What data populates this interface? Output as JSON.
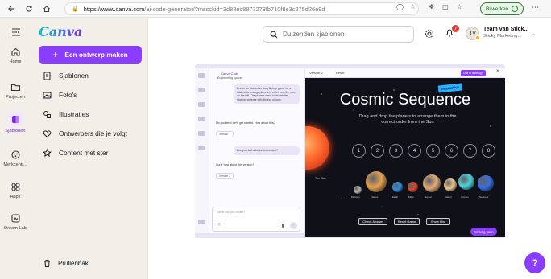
{
  "browser": {
    "url_host": "https://www.canva.com",
    "url_path": "/ai-code-generator/?mssckid=3d88ec8877278fb710f8e3c275d26e9d",
    "extension_label": "Bijwerken"
  },
  "brand": {
    "logo": "Canva",
    "accent": "#8b3dff"
  },
  "rail": {
    "items": [
      {
        "label": "Home",
        "icon": "home-icon"
      },
      {
        "label": "Projecten",
        "icon": "folder-icon"
      },
      {
        "label": "Sjablonen",
        "icon": "templates-icon"
      },
      {
        "label": "Merkcentr...",
        "icon": "brand-icon"
      },
      {
        "label": "Apps",
        "icon": "apps-icon"
      },
      {
        "label": "Dream Lab",
        "icon": "dream-lab-icon"
      }
    ]
  },
  "panel": {
    "create_label": "Een ontwerp maken",
    "menu": [
      {
        "label": "Sjablonen",
        "icon": "document-icon"
      },
      {
        "label": "Foto's",
        "icon": "image-icon"
      },
      {
        "label": "Illustraties",
        "icon": "shapes-icon"
      },
      {
        "label": "Ontwerpers die je volgt",
        "icon": "heart-icon"
      },
      {
        "label": "Content met ster",
        "icon": "star-icon"
      }
    ],
    "trash_label": "Prullenbak"
  },
  "topbar": {
    "search_placeholder": "Duizenden sjablonen",
    "notification_count": "7",
    "avatar_initials": "TV",
    "team_name": "Team van Stick...",
    "team_sub": "Sticky Marketing..."
  },
  "preview": {
    "chat": {
      "title": "Canva Code",
      "subtitle": "Engineering space",
      "bubble1": "Create an interactive drag & drop game for a student to arrange planets in order from the sun, on the left. The planets need to be detailed, glowing spheres with distinct colours.",
      "q1": "No problem! Let's get started. How about this?",
      "chip1": "Version 1",
      "bubble2": "Can you add a button for version?",
      "q2": "Sure, how about this version?",
      "chip2": "Version 2",
      "input_placeholder": "What will you create?"
    },
    "game": {
      "version_label": "Version 2",
      "reset_label": "Reset",
      "use_label": "Use in a design",
      "ribbon": "Interactive",
      "title": "Cosmic Sequence",
      "subtitle": "Drag and drop the planets to arrange them in the correct order from the Sun",
      "sun_label": "The Sun",
      "slots": [
        "1",
        "2",
        "3",
        "4",
        "5",
        "6",
        "7",
        "8"
      ],
      "planets": [
        {
          "name": "Mercury",
          "color": "#b9b4ae"
        },
        {
          "name": "Venus",
          "color": "#e3a153"
        },
        {
          "name": "Earth",
          "color": "#2f8ee0"
        },
        {
          "name": "Mars",
          "color": "#d6492c"
        },
        {
          "name": "Jupiter",
          "color": "#e3ab77"
        },
        {
          "name": "Saturn",
          "color": "#ecc78a"
        },
        {
          "name": "Uranus",
          "color": "#4fd1d6"
        },
        {
          "name": "Neptune",
          "color": "#3b6fe0"
        }
      ],
      "buttons": [
        "Check Answer",
        "Reset Game",
        "Show Hint"
      ],
      "coming_soon": "Coming soon"
    }
  },
  "help_label": "?"
}
